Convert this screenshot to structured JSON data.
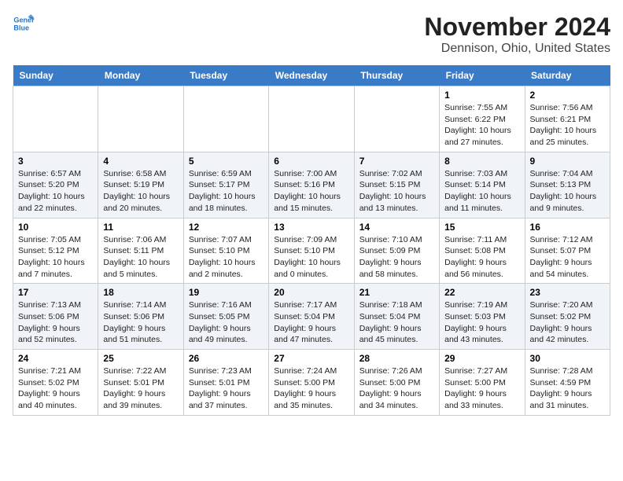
{
  "app": {
    "logo_line1": "General",
    "logo_line2": "Blue"
  },
  "title": "November 2024",
  "subtitle": "Dennison, Ohio, United States",
  "weekdays": [
    "Sunday",
    "Monday",
    "Tuesday",
    "Wednesday",
    "Thursday",
    "Friday",
    "Saturday"
  ],
  "weeks": [
    [
      {
        "day": "",
        "detail": ""
      },
      {
        "day": "",
        "detail": ""
      },
      {
        "day": "",
        "detail": ""
      },
      {
        "day": "",
        "detail": ""
      },
      {
        "day": "",
        "detail": ""
      },
      {
        "day": "1",
        "detail": "Sunrise: 7:55 AM\nSunset: 6:22 PM\nDaylight: 10 hours and 27 minutes."
      },
      {
        "day": "2",
        "detail": "Sunrise: 7:56 AM\nSunset: 6:21 PM\nDaylight: 10 hours and 25 minutes."
      }
    ],
    [
      {
        "day": "3",
        "detail": "Sunrise: 6:57 AM\nSunset: 5:20 PM\nDaylight: 10 hours and 22 minutes."
      },
      {
        "day": "4",
        "detail": "Sunrise: 6:58 AM\nSunset: 5:19 PM\nDaylight: 10 hours and 20 minutes."
      },
      {
        "day": "5",
        "detail": "Sunrise: 6:59 AM\nSunset: 5:17 PM\nDaylight: 10 hours and 18 minutes."
      },
      {
        "day": "6",
        "detail": "Sunrise: 7:00 AM\nSunset: 5:16 PM\nDaylight: 10 hours and 15 minutes."
      },
      {
        "day": "7",
        "detail": "Sunrise: 7:02 AM\nSunset: 5:15 PM\nDaylight: 10 hours and 13 minutes."
      },
      {
        "day": "8",
        "detail": "Sunrise: 7:03 AM\nSunset: 5:14 PM\nDaylight: 10 hours and 11 minutes."
      },
      {
        "day": "9",
        "detail": "Sunrise: 7:04 AM\nSunset: 5:13 PM\nDaylight: 10 hours and 9 minutes."
      }
    ],
    [
      {
        "day": "10",
        "detail": "Sunrise: 7:05 AM\nSunset: 5:12 PM\nDaylight: 10 hours and 7 minutes."
      },
      {
        "day": "11",
        "detail": "Sunrise: 7:06 AM\nSunset: 5:11 PM\nDaylight: 10 hours and 5 minutes."
      },
      {
        "day": "12",
        "detail": "Sunrise: 7:07 AM\nSunset: 5:10 PM\nDaylight: 10 hours and 2 minutes."
      },
      {
        "day": "13",
        "detail": "Sunrise: 7:09 AM\nSunset: 5:10 PM\nDaylight: 10 hours and 0 minutes."
      },
      {
        "day": "14",
        "detail": "Sunrise: 7:10 AM\nSunset: 5:09 PM\nDaylight: 9 hours and 58 minutes."
      },
      {
        "day": "15",
        "detail": "Sunrise: 7:11 AM\nSunset: 5:08 PM\nDaylight: 9 hours and 56 minutes."
      },
      {
        "day": "16",
        "detail": "Sunrise: 7:12 AM\nSunset: 5:07 PM\nDaylight: 9 hours and 54 minutes."
      }
    ],
    [
      {
        "day": "17",
        "detail": "Sunrise: 7:13 AM\nSunset: 5:06 PM\nDaylight: 9 hours and 52 minutes."
      },
      {
        "day": "18",
        "detail": "Sunrise: 7:14 AM\nSunset: 5:06 PM\nDaylight: 9 hours and 51 minutes."
      },
      {
        "day": "19",
        "detail": "Sunrise: 7:16 AM\nSunset: 5:05 PM\nDaylight: 9 hours and 49 minutes."
      },
      {
        "day": "20",
        "detail": "Sunrise: 7:17 AM\nSunset: 5:04 PM\nDaylight: 9 hours and 47 minutes."
      },
      {
        "day": "21",
        "detail": "Sunrise: 7:18 AM\nSunset: 5:04 PM\nDaylight: 9 hours and 45 minutes."
      },
      {
        "day": "22",
        "detail": "Sunrise: 7:19 AM\nSunset: 5:03 PM\nDaylight: 9 hours and 43 minutes."
      },
      {
        "day": "23",
        "detail": "Sunrise: 7:20 AM\nSunset: 5:02 PM\nDaylight: 9 hours and 42 minutes."
      }
    ],
    [
      {
        "day": "24",
        "detail": "Sunrise: 7:21 AM\nSunset: 5:02 PM\nDaylight: 9 hours and 40 minutes."
      },
      {
        "day": "25",
        "detail": "Sunrise: 7:22 AM\nSunset: 5:01 PM\nDaylight: 9 hours and 39 minutes."
      },
      {
        "day": "26",
        "detail": "Sunrise: 7:23 AM\nSunset: 5:01 PM\nDaylight: 9 hours and 37 minutes."
      },
      {
        "day": "27",
        "detail": "Sunrise: 7:24 AM\nSunset: 5:00 PM\nDaylight: 9 hours and 35 minutes."
      },
      {
        "day": "28",
        "detail": "Sunrise: 7:26 AM\nSunset: 5:00 PM\nDaylight: 9 hours and 34 minutes."
      },
      {
        "day": "29",
        "detail": "Sunrise: 7:27 AM\nSunset: 5:00 PM\nDaylight: 9 hours and 33 minutes."
      },
      {
        "day": "30",
        "detail": "Sunrise: 7:28 AM\nSunset: 4:59 PM\nDaylight: 9 hours and 31 minutes."
      }
    ]
  ]
}
